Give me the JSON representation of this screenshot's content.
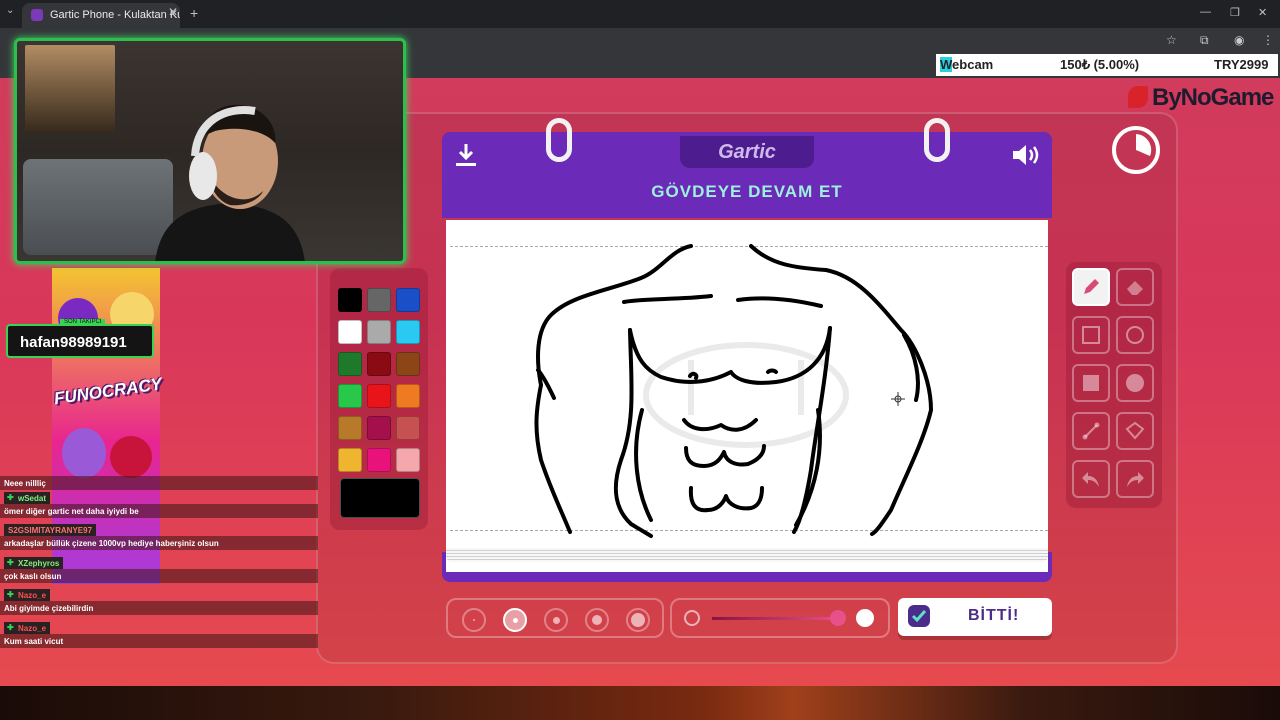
{
  "browser": {
    "tab_title": "Gartic Phone - Kulaktan Kulağa",
    "new_tab_symbol": "+",
    "close_symbol": "✕",
    "window_controls": [
      "—",
      "❐",
      "✕"
    ]
  },
  "stream_overlay": {
    "donation": {
      "label_highlight": "W",
      "label_rest": "ebcam",
      "amount": "150₺ (5.00%)",
      "goal": "TRY2999"
    },
    "brand": "ByNoGame",
    "name_tag": "hafan98989191",
    "name_tag_small": "SON TAKIPCI",
    "sticker_text": "FUNOCRACY"
  },
  "game": {
    "logo": "Gartic",
    "prompt": "GÖVDEYE DEVAM ET",
    "done_button": "BİTTİ!",
    "brush_sizes": 5,
    "active_brush_size_index": 1,
    "palette": [
      "#000000",
      "#666666",
      "#1a4fc8",
      "#ffffff",
      "#aaaaaa",
      "#29c9f2",
      "#1e7a2a",
      "#8a0c12",
      "#8b4516",
      "#28c84a",
      "#e8141a",
      "#f07a22",
      "#b87a2a",
      "#a3104c",
      "#c75050",
      "#f0b530",
      "#e8127a",
      "#f4a8ac"
    ],
    "selected_color": "#000000",
    "tools": [
      {
        "name": "pencil",
        "active": true
      },
      {
        "name": "eraser",
        "active": false
      },
      {
        "name": "rectangle-outline",
        "active": false
      },
      {
        "name": "circle-outline",
        "active": false
      },
      {
        "name": "rectangle-filled",
        "active": false
      },
      {
        "name": "circle-filled",
        "active": false
      },
      {
        "name": "line",
        "active": false
      },
      {
        "name": "fill-bucket",
        "active": false
      },
      {
        "name": "undo",
        "active": false
      },
      {
        "name": "redo",
        "active": false
      }
    ],
    "opacity_slider_value": 1.0
  },
  "chat": [
    {
      "user": "",
      "message": "Neee nillliç"
    },
    {
      "user": "wSedat",
      "user_style": "green",
      "message": "ömer diğer gartic net daha iyiydi be"
    },
    {
      "user": "S2GSIMITAYRANYE97",
      "user_style": "badges",
      "message": "arkadaşlar büllük çizene 1000vp hediye haberşiniz olsun"
    },
    {
      "user": "XZephyros",
      "user_style": "green",
      "message": "çok kaslı olsun"
    },
    {
      "user": "Nazo_e",
      "user_style": "red",
      "message": "Abi giyimde çizebilirdin"
    },
    {
      "user": "Nazo_e",
      "user_style": "red",
      "message": "Kum saati vicut"
    }
  ]
}
